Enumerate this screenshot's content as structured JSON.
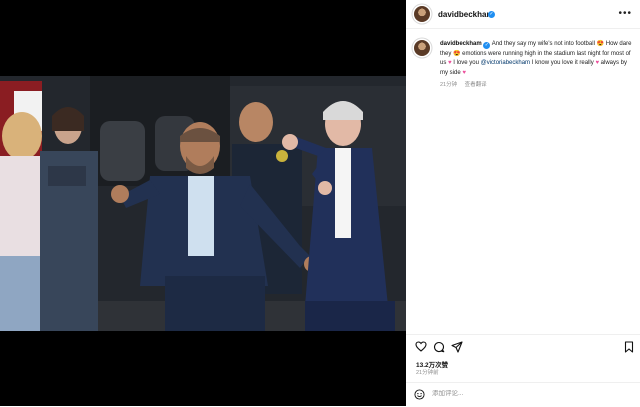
{
  "post": {
    "username": "davidbeckham",
    "caption": {
      "text1": "And they say my wife's not into football",
      "text2": "How dare they",
      "text3": "emotions were running high in the stadium last night for most of us",
      "text4": "I love you",
      "mention": "@victoriabeckham",
      "text5": "I know you love it really",
      "text6": "always by my side"
    },
    "time_ago": "21分钟",
    "translate_label": "查看翻译",
    "likes": "13.2万次赞",
    "date": "21分钟前",
    "comment_placeholder": "添加评论..."
  },
  "icons": {
    "header_more": "more-icon",
    "like": "heart-icon",
    "comment": "comment-icon",
    "share": "share-icon",
    "save": "bookmark-icon",
    "emoji": "emoji-icon",
    "caption_emojis": [
      "heart-eyes-emoji",
      "pink-heart-emoji"
    ]
  },
  "colors": {
    "verified": "#1f8ef1",
    "link": "#00376b",
    "heart_emoji": "#ed4e9b"
  }
}
